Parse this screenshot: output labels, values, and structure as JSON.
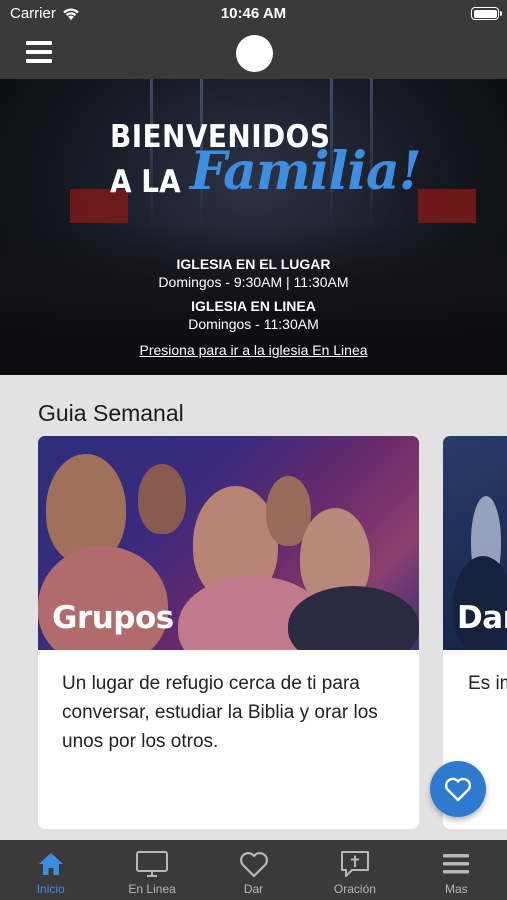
{
  "status_bar": {
    "carrier": "Carrier",
    "time": "10:46 AM",
    "battery_level": 1.0
  },
  "nav": {
    "menu_icon": "hamburger-icon",
    "logo": "app-logo"
  },
  "hero": {
    "title_line1": "BIENVENIDOS",
    "title_line2": "A LA",
    "title_script": "Familia!",
    "in_person_heading": "IGLESIA EN EL LUGAR",
    "in_person_times": "Domingos - 9:30AM | 11:30AM",
    "online_heading": "IGLESIA EN LINEA",
    "online_times": "Domingos - 11:30AM",
    "online_link": "Presiona para ir a la iglesia En Linea",
    "accent_color": "#3d8ee0"
  },
  "section": {
    "title": "Guia Semanal"
  },
  "cards": [
    {
      "title": "Grupos",
      "description": "Un lugar de refugio cerca de ti para conversar, estudiar la Biblia y orar los unos por los otros."
    },
    {
      "title": "Dar",
      "description": "Es im haci alcar ayud mod"
    }
  ],
  "fab": {
    "icon": "heart-icon",
    "color": "#2e7ad0"
  },
  "tab_bar": {
    "active_color": "#3d8ee0",
    "tabs": [
      {
        "label": "Inicio",
        "icon": "home-icon",
        "active": true
      },
      {
        "label": "En Linea",
        "icon": "monitor-icon",
        "active": false
      },
      {
        "label": "Dar",
        "icon": "heart-icon",
        "active": false
      },
      {
        "label": "Oración",
        "icon": "prayer-bubble-icon",
        "active": false
      },
      {
        "label": "Mas",
        "icon": "menu-lines-icon",
        "active": false
      }
    ]
  }
}
